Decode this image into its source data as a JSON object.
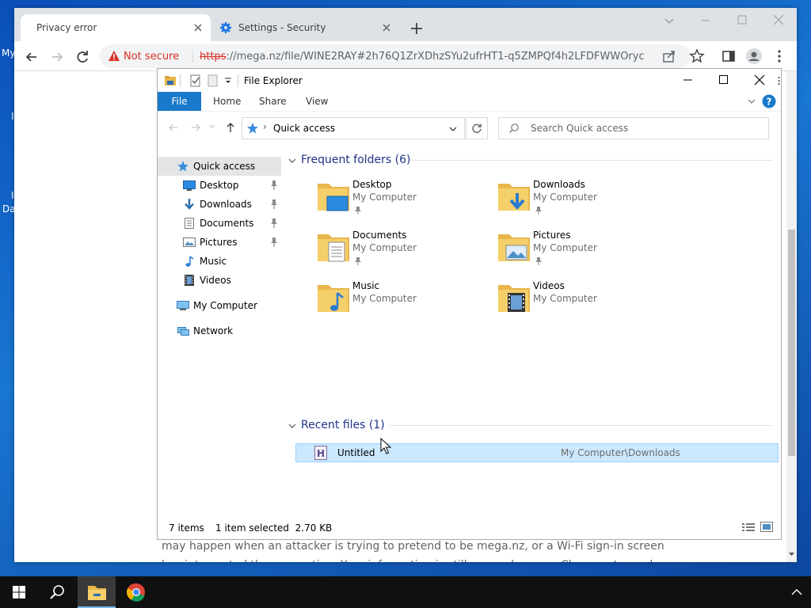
{
  "desktop": {
    "frag1": "My",
    "frag2": "Da"
  },
  "browser": {
    "tabs": [
      {
        "label": "Privacy error",
        "active": true
      },
      {
        "label": "Settings - Security",
        "active": false
      }
    ],
    "not_secure": "Not secure",
    "url_scheme": "https",
    "url_rest": "://mega.nz/file/WINE2RAY#2h76Q1ZrXDhzSYu2ufrHT1-q5ZMPQf4h2LFDFWWOryc",
    "page_text": "may happen when an attacker is trying to pretend to be mega.nz, or a Wi-Fi sign-in screen",
    "page_text_2": "has interrupted the connection. Your information is still secure because Chrome stopped"
  },
  "explorer": {
    "title": "File Explorer",
    "ribbon": {
      "file": "File",
      "home": "Home",
      "share": "Share",
      "view": "View"
    },
    "address": "Quick access",
    "search_placeholder": "Search Quick access",
    "nav": {
      "quick_access": "Quick access",
      "desktop": "Desktop",
      "downloads": "Downloads",
      "documents": "Documents",
      "pictures": "Pictures",
      "music": "Music",
      "videos": "Videos",
      "my_computer": "My Computer",
      "network": "Network"
    },
    "frequent_header": "Frequent folders (6)",
    "folders": [
      {
        "name": "Desktop",
        "location": "My Computer",
        "icon": "desktop-folder-icon",
        "pinned": true
      },
      {
        "name": "Downloads",
        "location": "My Computer",
        "icon": "downloads-folder-icon",
        "pinned": true
      },
      {
        "name": "Documents",
        "location": "My Computer",
        "icon": "documents-folder-icon",
        "pinned": true
      },
      {
        "name": "Pictures",
        "location": "My Computer",
        "icon": "pictures-folder-icon",
        "pinned": true
      },
      {
        "name": "Music",
        "location": "My Computer",
        "icon": "music-folder-icon",
        "pinned": false
      },
      {
        "name": "Videos",
        "location": "My Computer",
        "icon": "videos-folder-icon",
        "pinned": false
      }
    ],
    "recent_header": "Recent files (1)",
    "recent_files": [
      {
        "name": "Untitled",
        "path": "My Computer\\Downloads"
      }
    ],
    "status": {
      "items": "7 items",
      "selected": "1 item selected  2.70 KB"
    }
  },
  "colors": {
    "accent": "#1979ca",
    "selection": "#cce8ff",
    "warning": "#d93025",
    "group_header": "#1e3287"
  }
}
